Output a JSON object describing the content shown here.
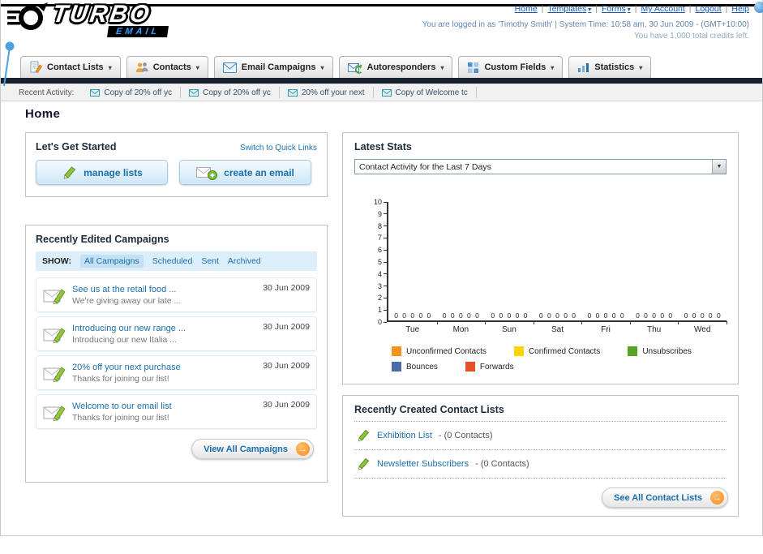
{
  "icons": {
    "dropdown_arrow": "▾",
    "select_arrow": "▼",
    "go_arrow": "→"
  },
  "header": {
    "logo_main": "TURBO",
    "logo_sub": "EMAIL",
    "links": [
      {
        "label": "Home",
        "dropdown": false
      },
      {
        "label": "Templates",
        "dropdown": true
      },
      {
        "label": "Forms",
        "dropdown": true
      },
      {
        "label": "My Account",
        "dropdown": false
      },
      {
        "label": "Logout",
        "dropdown": false
      },
      {
        "label": "Help",
        "dropdown": false
      }
    ],
    "login_info": "You are logged in as 'Timothy Smith' | System Time: 10:58 am, 30 Jun 2009 - (GMT+10:00)",
    "credits": "You have 1,000 total credits left."
  },
  "nav": {
    "tabs": [
      {
        "label": "Contact Lists"
      },
      {
        "label": "Contacts"
      },
      {
        "label": "Email Campaigns"
      },
      {
        "label": "Autoresponders"
      },
      {
        "label": "Custom Fields"
      },
      {
        "label": "Statistics"
      }
    ]
  },
  "recent_activity": {
    "label": "Recent Activity:",
    "items": [
      {
        "label": "Copy of 20% off yc"
      },
      {
        "label": "Copy of 20% off yc"
      },
      {
        "label": "20% off your next"
      },
      {
        "label": "Copy of Welcome tc"
      }
    ]
  },
  "page": {
    "title": "Home"
  },
  "get_started": {
    "title": "Let's Get Started",
    "switch_link": "Switch to Quick Links",
    "buttons": [
      {
        "label": "manage lists"
      },
      {
        "label": "create an email"
      }
    ]
  },
  "campaigns": {
    "title": "Recently Edited Campaigns",
    "show_label": "SHOW:",
    "filters": [
      {
        "label": "All Campaigns",
        "active": true
      },
      {
        "label": "Scheduled",
        "active": false
      },
      {
        "label": "Sent",
        "active": false
      },
      {
        "label": "Archived",
        "active": false
      }
    ],
    "items": [
      {
        "title": "See us at the retail food ...",
        "subtitle": "We're giving away our late ...",
        "date": "30 Jun 2009"
      },
      {
        "title": "Introducing our new range ...",
        "subtitle": "Introducing our new Italia ...",
        "date": "30 Jun 2009"
      },
      {
        "title": "20% off your next purchase",
        "subtitle": "Thanks for joining our list!",
        "date": "30 Jun 2009"
      },
      {
        "title": "Welcome to our email list",
        "subtitle": "Thanks for joining our list!",
        "date": "30 Jun 2009"
      }
    ],
    "view_all_label": "View All Campaigns"
  },
  "stats": {
    "title": "Latest Stats",
    "dropdown_value": "Contact Activity for the Last 7 Days",
    "chart_data": {
      "type": "bar",
      "title": "Contact Activity for the Last 7 Days",
      "categories": [
        "Tue",
        "Mon",
        "Sun",
        "Sat",
        "Fri",
        "Thu",
        "Wed"
      ],
      "series": [
        {
          "name": "Unconfirmed Contacts",
          "color": "#f6921e",
          "values": [
            0,
            0,
            0,
            0,
            0,
            0,
            0
          ]
        },
        {
          "name": "Confirmed Contacts",
          "color": "#ffd400",
          "values": [
            0,
            0,
            0,
            0,
            0,
            0,
            0
          ]
        },
        {
          "name": "Unsubscribes",
          "color": "#5aa322",
          "values": [
            0,
            0,
            0,
            0,
            0,
            0,
            0
          ]
        },
        {
          "name": "Bounces",
          "color": "#4a6da7",
          "values": [
            0,
            0,
            0,
            0,
            0,
            0,
            0
          ]
        },
        {
          "name": "Forwards",
          "color": "#e8502a",
          "values": [
            0,
            0,
            0,
            0,
            0,
            0,
            0
          ]
        }
      ],
      "ylim": [
        0,
        10
      ],
      "xlabel": "",
      "ylabel": "",
      "grid": false,
      "legend_position": "bottom",
      "value_labels_shown": true
    }
  },
  "contact_lists": {
    "title": "Recently Created Contact Lists",
    "items": [
      {
        "name": "Exhibition List",
        "count": "- (0 Contacts)"
      },
      {
        "name": "Newsletter Subscribers",
        "count": "- (0 Contacts)"
      }
    ],
    "see_all_label": "See All Contact Lists"
  },
  "colors": {
    "accent_orange": "#f6921e",
    "link_blue": "#1b6fad",
    "nav_dark": "#18222f"
  }
}
